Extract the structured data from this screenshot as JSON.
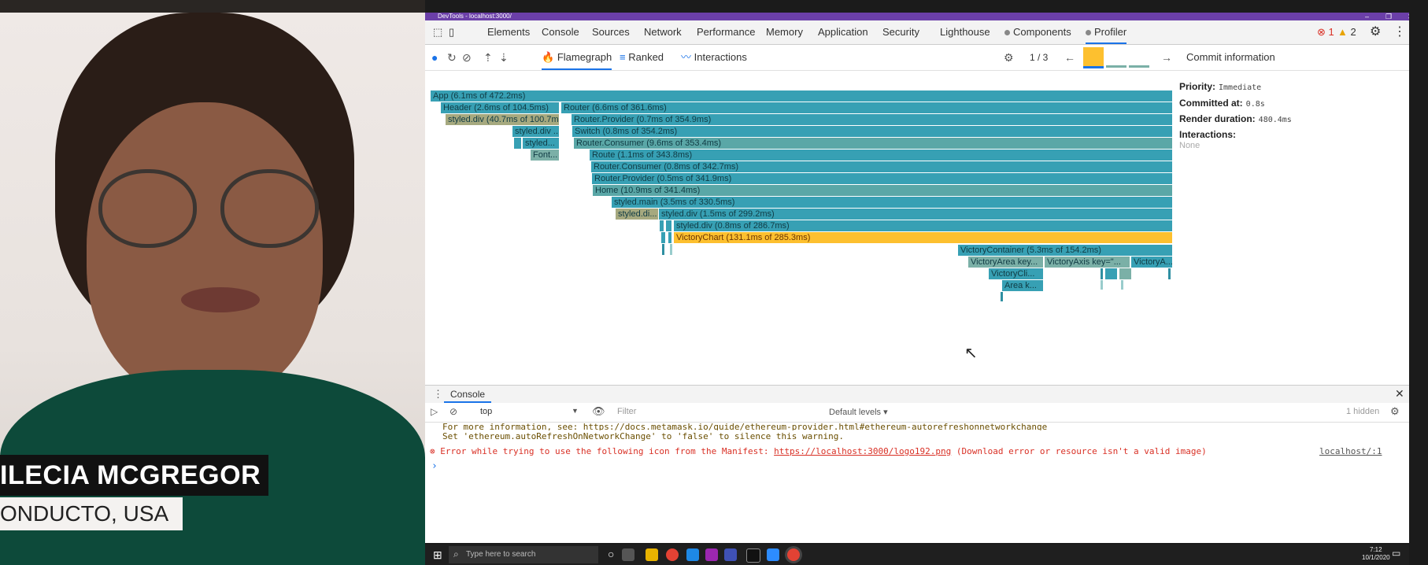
{
  "presenter": {
    "name": "ILECIA MCGREGOR",
    "org": "ONDUCTO, USA"
  },
  "window": {
    "title": "DevTools - localhost:3000/"
  },
  "devtools_tabs": [
    {
      "label": "Elements"
    },
    {
      "label": "Console"
    },
    {
      "label": "Sources"
    },
    {
      "label": "Network"
    },
    {
      "label": "Performance"
    },
    {
      "label": "Memory"
    },
    {
      "label": "Application"
    },
    {
      "label": "Security"
    },
    {
      "label": "Lighthouse"
    },
    {
      "label": "Components"
    },
    {
      "label": "Profiler"
    }
  ],
  "status": {
    "errors": "1",
    "warnings": "2"
  },
  "profiler": {
    "views": {
      "flamegraph": "Flamegraph",
      "ranked": "Ranked",
      "interactions": "Interactions"
    },
    "commit_index": "1 / 3",
    "commit_panel_title": "Commit information"
  },
  "flamegraph": [
    {
      "label": "App (6.1ms of 472.2ms)"
    },
    {
      "label": "Header (2.6ms of 104.5ms)"
    },
    {
      "label": "Router (6.6ms of 361.6ms)"
    },
    {
      "label": "styled.div (40.7ms of 100.7ms)"
    },
    {
      "label": "Router.Provider (0.7ms of 354.9ms)"
    },
    {
      "label": "styled.div ..."
    },
    {
      "label": "Switch (0.8ms of 354.2ms)"
    },
    {
      "label": "styled..."
    },
    {
      "label": "Router.Consumer (9.6ms of 353.4ms)"
    },
    {
      "label": "Font..."
    },
    {
      "label": "Route (1.1ms of 343.8ms)"
    },
    {
      "label": "Router.Consumer (0.8ms of 342.7ms)"
    },
    {
      "label": "Router.Provider (0.5ms of 341.9ms)"
    },
    {
      "label": "Home (10.9ms of 341.4ms)"
    },
    {
      "label": "styled.main (3.5ms of 330.5ms)"
    },
    {
      "label": "styled.di..."
    },
    {
      "label": "styled.div (1.5ms of 299.2ms)"
    },
    {
      "label": "styled.div (0.8ms of 286.7ms)"
    },
    {
      "label": "VictoryChart (131.1ms of 285.3ms)"
    },
    {
      "label": "VictoryContainer (5.3ms of 154.2ms)"
    },
    {
      "label": "VictoryArea key..."
    },
    {
      "label": "VictoryAxis key=\"..."
    },
    {
      "label": "VictoryA..."
    },
    {
      "label": "VictoryCli..."
    },
    {
      "label": "Area k..."
    }
  ],
  "commit_info": {
    "priority_label": "Priority:",
    "priority_value": "Immediate",
    "committed_label": "Committed at:",
    "committed_value": "0.8s",
    "render_label": "Render duration:",
    "render_value": "480.4ms",
    "interactions_label": "Interactions:",
    "interactions_value": "None"
  },
  "console": {
    "tab": "Console",
    "context": "top",
    "filter_placeholder": "Filter",
    "levels": "Default levels ▾",
    "hidden": "1 hidden",
    "line1": "For more information, see: https://docs.metamask.io/guide/ethereum-provider.html#ethereum-autorefreshonnetworkchange",
    "line2": "Set 'ethereum.autoRefreshOnNetworkChange' to 'false' to silence this warning.",
    "error_prefix": "Error while trying to use the following icon from the Manifest: ",
    "error_link": "https://localhost:3000/logo192.png",
    "error_suffix": " (Download error or resource isn't a valid image)",
    "error_source": "localhost/:1",
    "prompt": "›"
  },
  "taskbar": {
    "search_placeholder": "Type here to search",
    "time": "7:12",
    "date": "10/1/2020"
  }
}
